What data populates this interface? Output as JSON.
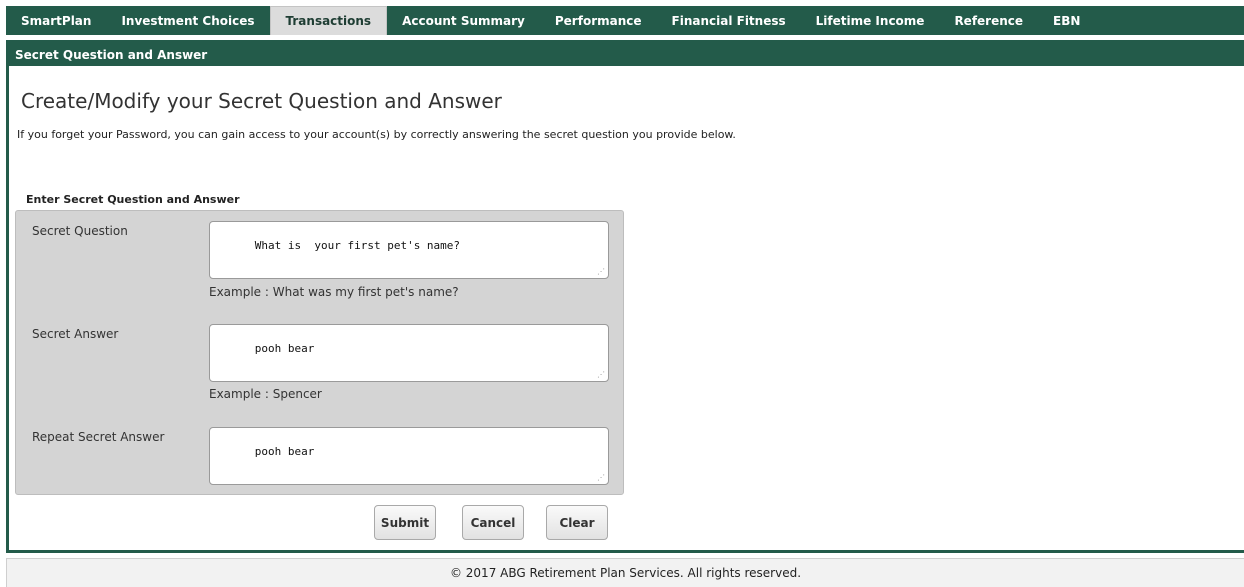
{
  "nav": {
    "tabs": [
      {
        "label": "SmartPlan"
      },
      {
        "label": "Investment Choices"
      },
      {
        "label": "Transactions"
      },
      {
        "label": "Account Summary"
      },
      {
        "label": "Performance"
      },
      {
        "label": "Financial Fitness"
      },
      {
        "label": "Lifetime Income"
      },
      {
        "label": "Reference"
      },
      {
        "label": "EBN"
      }
    ],
    "active_tab": "Transactions"
  },
  "section": {
    "header": "Secret Question and Answer",
    "title": "Create/Modify your Secret Question and Answer",
    "intro": "If you forget your Password, you can gain access to your account(s) by correctly answering the secret question you provide below."
  },
  "form": {
    "heading": "Enter Secret Question and Answer",
    "question": {
      "label": "Secret Question",
      "value": "What is  your first pet's name?",
      "example": "Example : What was my first pet's name?"
    },
    "answer": {
      "label": "Secret Answer",
      "value": "pooh bear",
      "example": "Example : Spencer"
    },
    "repeat": {
      "label": "Repeat Secret Answer",
      "value": "pooh bear"
    }
  },
  "buttons": {
    "submit": "Submit",
    "cancel": "Cancel",
    "clear": "Clear"
  },
  "footer": {
    "text": "© 2017 ABG Retirement Plan Services. All rights reserved."
  },
  "colors": {
    "brand": "#235b4a",
    "panel": "#d4d4d4"
  }
}
